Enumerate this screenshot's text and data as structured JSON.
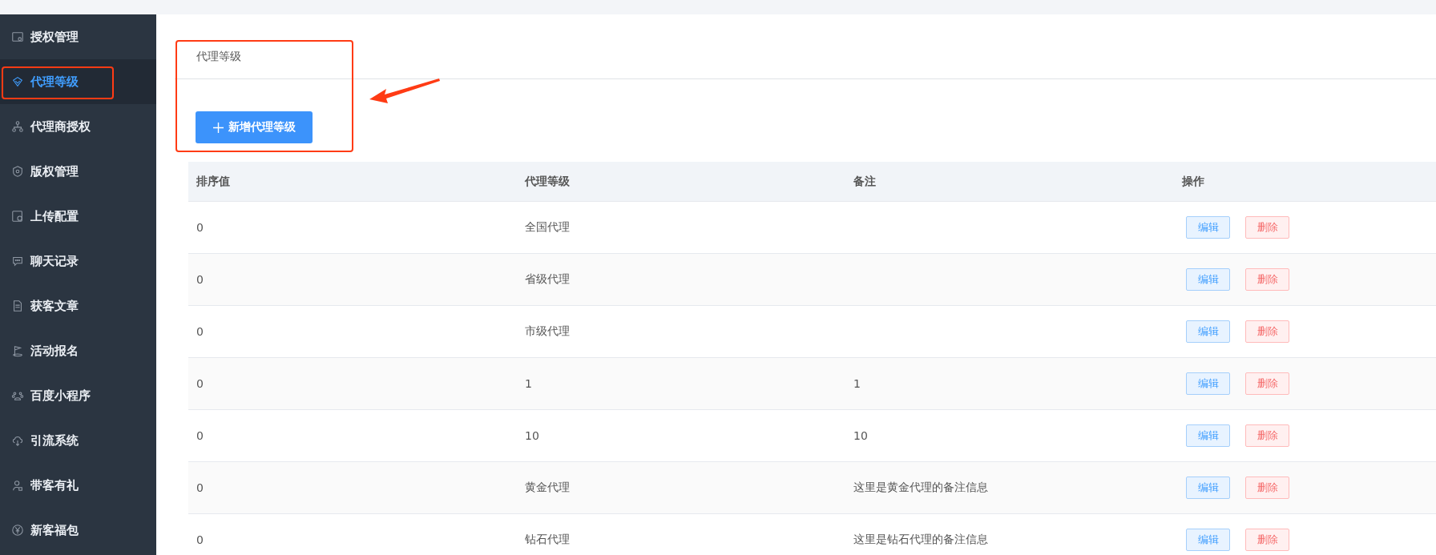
{
  "sidebar": {
    "items": [
      {
        "label": "授权管理",
        "selected": false
      },
      {
        "label": "代理等级",
        "selected": true
      },
      {
        "label": "代理商授权",
        "selected": false
      },
      {
        "label": "版权管理",
        "selected": false
      },
      {
        "label": "上传配置",
        "selected": false
      },
      {
        "label": "聊天记录",
        "selected": false
      },
      {
        "label": "获客文章",
        "selected": false
      },
      {
        "label": "活动报名",
        "selected": false
      },
      {
        "label": "百度小程序",
        "selected": false
      },
      {
        "label": "引流系统",
        "selected": false
      },
      {
        "label": "带客有礼",
        "selected": false
      },
      {
        "label": "新客福包",
        "selected": false
      }
    ]
  },
  "panel": {
    "title": "代理等级",
    "add_button": "新增代理等级"
  },
  "table": {
    "columns": [
      "排序值",
      "代理等级",
      "备注",
      "操作"
    ],
    "rows": [
      {
        "sort": "0",
        "level": "全国代理",
        "note": "",
        "actions": [
          "编辑",
          "删除"
        ]
      },
      {
        "sort": "0",
        "level": "省级代理",
        "note": "",
        "actions": [
          "编辑",
          "删除"
        ]
      },
      {
        "sort": "0",
        "level": "市级代理",
        "note": "",
        "actions": [
          "编辑",
          "删除"
        ]
      },
      {
        "sort": "0",
        "level": "1",
        "note": "1",
        "actions": [
          "编辑",
          "删除"
        ]
      },
      {
        "sort": "0",
        "level": "10",
        "note": "10",
        "actions": [
          "编辑",
          "删除"
        ]
      },
      {
        "sort": "0",
        "level": "黄金代理",
        "note": "这里是黄金代理的备注信息",
        "actions": [
          "编辑",
          "删除"
        ]
      },
      {
        "sort": "0",
        "level": "钻石代理",
        "note": "这里是钻石代理的备注信息",
        "actions": [
          "编辑",
          "删除"
        ]
      }
    ]
  },
  "annotations": [
    {
      "kind": "frame"
    },
    {
      "kind": "frame"
    },
    {
      "kind": "arrow"
    }
  ]
}
